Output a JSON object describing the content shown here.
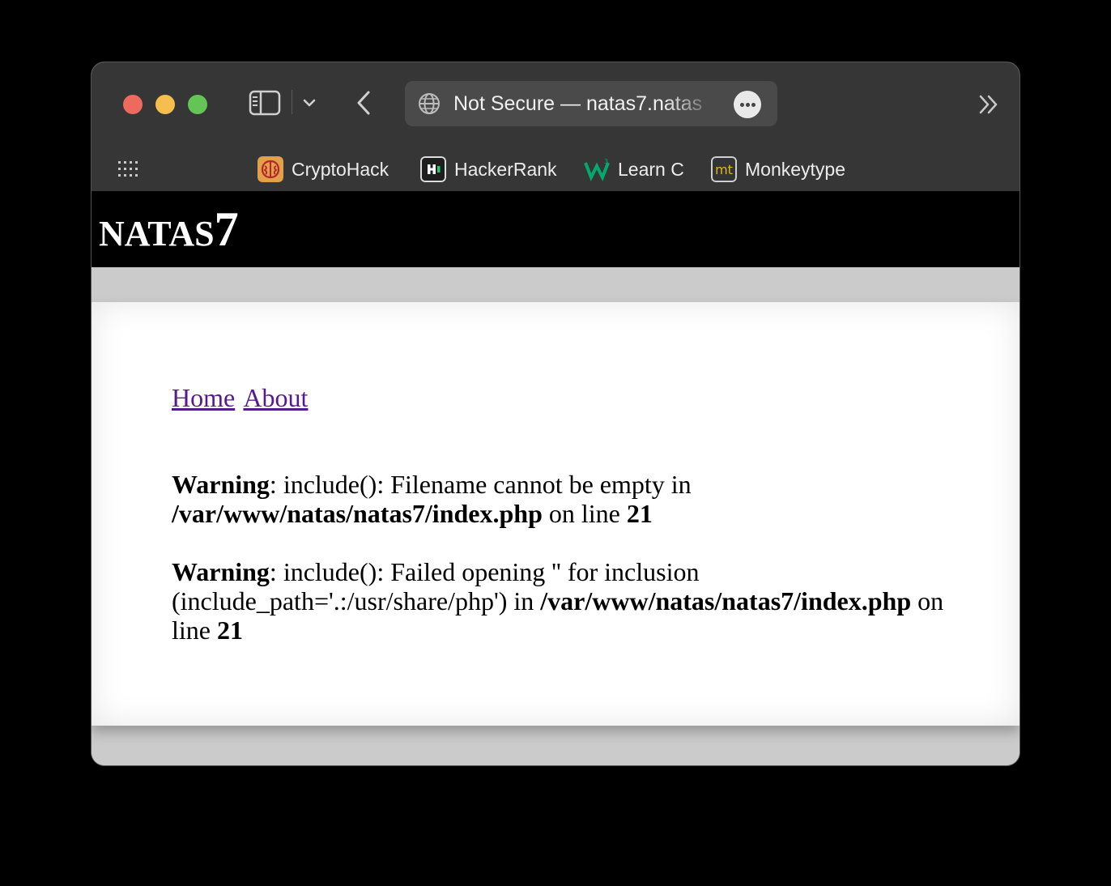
{
  "browser": {
    "address": "Not Secure — natas7.natas",
    "bookmarks": [
      {
        "label": "CryptoHack",
        "icon": "cryptohack-icon",
        "color": "#e2a04a"
      },
      {
        "label": "HackerRank",
        "icon": "hackerrank-icon",
        "color": "#1e1e1e"
      },
      {
        "label": "Learn C",
        "icon": "w3schools-icon",
        "color": "#04aa6d"
      },
      {
        "label": "Monkeytype",
        "icon": "monkeytype-icon",
        "color": "#e2b714"
      }
    ]
  },
  "page": {
    "title_prefix": "NATAS",
    "title_number": "7",
    "nav": {
      "home": "Home",
      "about": "About"
    },
    "warnings": [
      {
        "label": "Warning",
        "message": ": include(): Filename cannot be empty in ",
        "file": "/var/www/natas/natas7/index.php",
        "on_line": " on line ",
        "line": "21"
      },
      {
        "label": "Warning",
        "message": ": include(): Failed opening '' for inclusion (include_path='.:/usr/share/php') in ",
        "file": "/var/www/natas/natas7/index.php",
        "on_line": " on line ",
        "line": "21"
      }
    ]
  }
}
